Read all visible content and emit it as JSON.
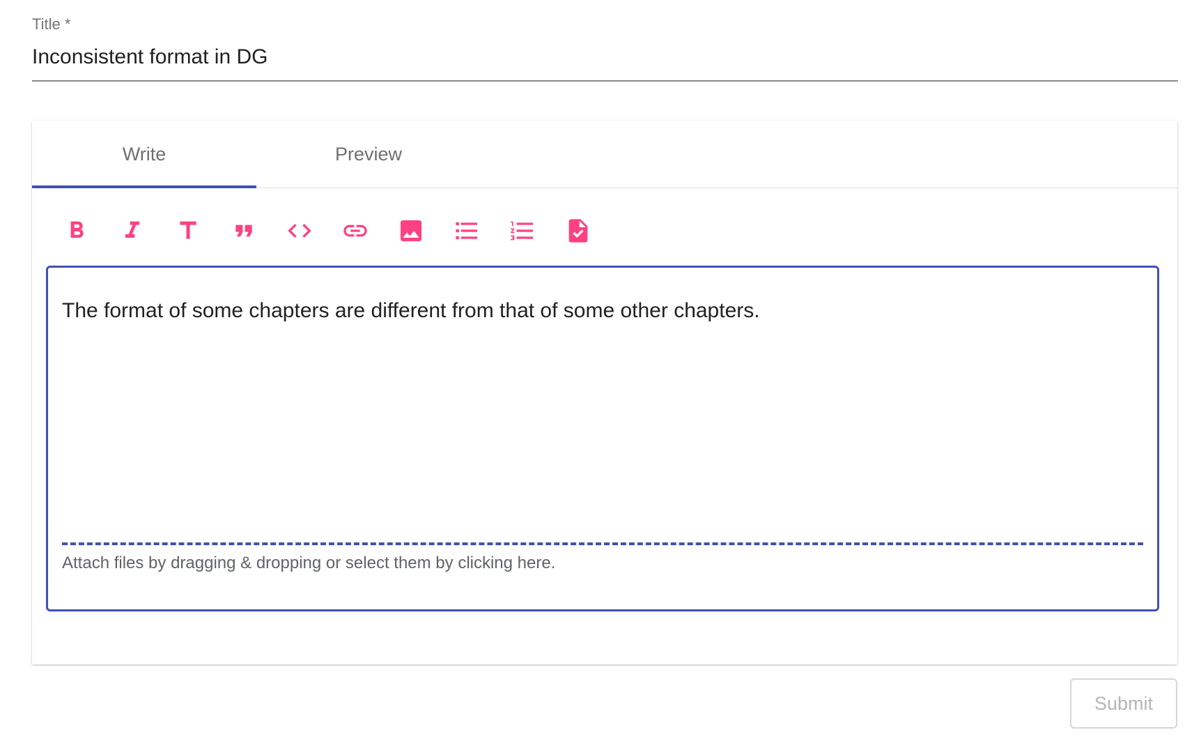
{
  "title_field": {
    "label": "Title *",
    "value": "Inconsistent format in DG"
  },
  "editor": {
    "tabs": [
      {
        "label": "Write",
        "active": true
      },
      {
        "label": "Preview",
        "active": false
      }
    ],
    "toolbar": [
      {
        "icon": "bold-icon"
      },
      {
        "icon": "italic-icon"
      },
      {
        "icon": "heading-icon"
      },
      {
        "icon": "quote-icon"
      },
      {
        "icon": "code-icon"
      },
      {
        "icon": "link-icon"
      },
      {
        "icon": "image-icon"
      },
      {
        "icon": "bulleted-list-icon"
      },
      {
        "icon": "numbered-list-icon"
      },
      {
        "icon": "task-list-icon"
      }
    ],
    "body_text": "The format of some chapters are different from that of some other chapters.",
    "attach_hint": "Attach files by dragging & dropping or select them by clicking here."
  },
  "submit": {
    "label": "Submit",
    "disabled": true
  },
  "colors": {
    "accent": "#3f51b5",
    "icon": "#ff4081",
    "label": "#757575"
  }
}
